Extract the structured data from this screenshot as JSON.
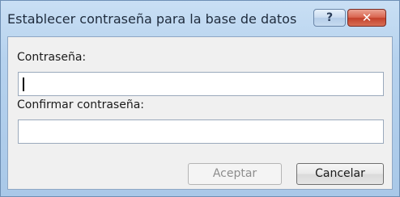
{
  "dialog": {
    "title": "Establecer contraseña para la base de datos",
    "help_label": "?",
    "close_label": "✕"
  },
  "fields": {
    "password_label": "Contraseña:",
    "password_value": "",
    "confirm_label": "Confirmar contraseña:",
    "confirm_value": ""
  },
  "buttons": {
    "accept_label": "Aceptar",
    "cancel_label": "Cancelar"
  },
  "colors": {
    "title_bar": "#b6d2ee",
    "close_button": "#c4412b",
    "client_background": "#f0f0f0"
  }
}
